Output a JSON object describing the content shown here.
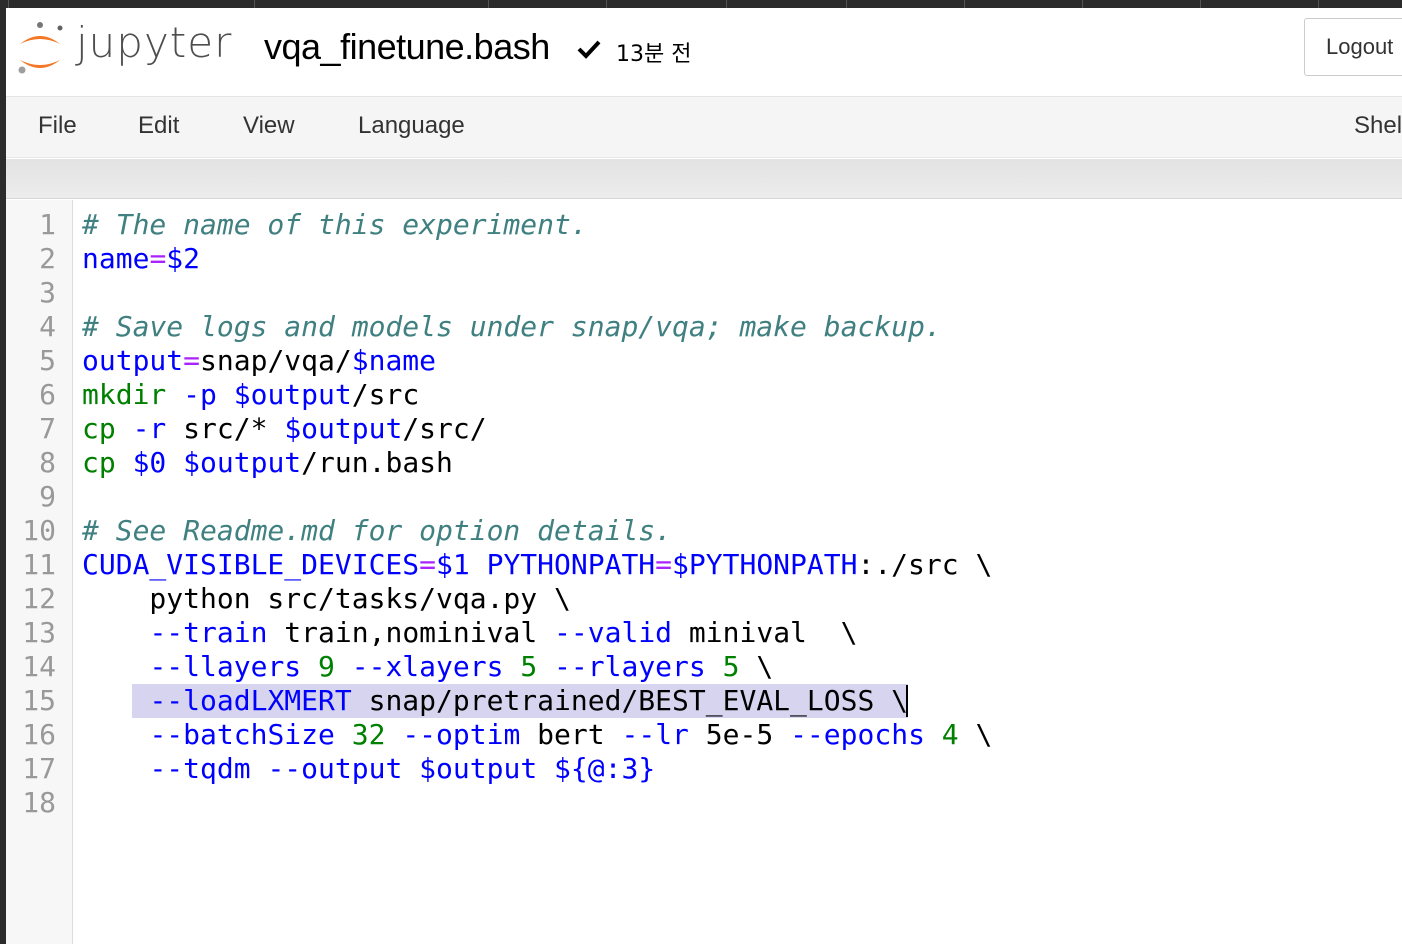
{
  "header": {
    "logo_text": "jupyter",
    "notebook_name": "vqa_finetune.bash",
    "last_saved": "13분 전",
    "logout_label": "Logout"
  },
  "menubar": {
    "items": [
      "File",
      "Edit",
      "View",
      "Language"
    ],
    "right_item": "Shel"
  },
  "editor": {
    "highlighted_line": 15,
    "lines": [
      {
        "n": "1",
        "tokens": [
          [
            "c",
            "# The name of this experiment."
          ]
        ]
      },
      {
        "n": "2",
        "tokens": [
          [
            "v",
            "name"
          ],
          [
            "o",
            "="
          ],
          [
            "v",
            "$2"
          ]
        ]
      },
      {
        "n": "3",
        "tokens": []
      },
      {
        "n": "4",
        "tokens": [
          [
            "c",
            "# Save logs and models under snap/vqa; make backup."
          ]
        ]
      },
      {
        "n": "5",
        "tokens": [
          [
            "v",
            "output"
          ],
          [
            "o",
            "="
          ],
          [
            "p",
            "snap/vqa/"
          ],
          [
            "v",
            "$name"
          ]
        ]
      },
      {
        "n": "6",
        "tokens": [
          [
            "b",
            "mkdir"
          ],
          [
            "p",
            " "
          ],
          [
            "v",
            "-p"
          ],
          [
            "p",
            " "
          ],
          [
            "v",
            "$output"
          ],
          [
            "p",
            "/src"
          ]
        ]
      },
      {
        "n": "7",
        "tokens": [
          [
            "b",
            "cp"
          ],
          [
            "p",
            " "
          ],
          [
            "v",
            "-r"
          ],
          [
            "p",
            " src/* "
          ],
          [
            "v",
            "$output"
          ],
          [
            "p",
            "/src/"
          ]
        ]
      },
      {
        "n": "8",
        "tokens": [
          [
            "b",
            "cp"
          ],
          [
            "p",
            " "
          ],
          [
            "v",
            "$0"
          ],
          [
            "p",
            " "
          ],
          [
            "v",
            "$output"
          ],
          [
            "p",
            "/run.bash"
          ]
        ]
      },
      {
        "n": "9",
        "tokens": []
      },
      {
        "n": "10",
        "tokens": [
          [
            "c",
            "# See Readme.md for option details."
          ]
        ]
      },
      {
        "n": "11",
        "tokens": [
          [
            "v",
            "CUDA_VISIBLE_DEVICES"
          ],
          [
            "o",
            "="
          ],
          [
            "v",
            "$1"
          ],
          [
            "p",
            " "
          ],
          [
            "v",
            "PYTHONPATH"
          ],
          [
            "o",
            "="
          ],
          [
            "v",
            "$PYTHONPATH"
          ],
          [
            "p",
            ":./src \\"
          ]
        ]
      },
      {
        "n": "12",
        "tokens": [
          [
            "p",
            "    python src/tasks/vqa.py \\"
          ]
        ]
      },
      {
        "n": "13",
        "tokens": [
          [
            "p",
            "    "
          ],
          [
            "v",
            "--train"
          ],
          [
            "p",
            " train,nominival "
          ],
          [
            "v",
            "--valid"
          ],
          [
            "p",
            " minival  \\"
          ]
        ]
      },
      {
        "n": "14",
        "tokens": [
          [
            "p",
            "    "
          ],
          [
            "v",
            "--llayers"
          ],
          [
            "p",
            " "
          ],
          [
            "n",
            "9"
          ],
          [
            "p",
            " "
          ],
          [
            "v",
            "--xlayers"
          ],
          [
            "p",
            " "
          ],
          [
            "n",
            "5"
          ],
          [
            "p",
            " "
          ],
          [
            "v",
            "--rlayers"
          ],
          [
            "p",
            " "
          ],
          [
            "n",
            "5"
          ],
          [
            "p",
            " \\"
          ]
        ]
      },
      {
        "n": "15",
        "tokens": [
          [
            "p",
            "    "
          ],
          [
            "v",
            "--loadLXMERT"
          ],
          [
            "p",
            " snap/pretrained/BEST_EVAL_LOSS \\"
          ]
        ]
      },
      {
        "n": "16",
        "tokens": [
          [
            "p",
            "    "
          ],
          [
            "v",
            "--batchSize"
          ],
          [
            "p",
            " "
          ],
          [
            "n",
            "32"
          ],
          [
            "p",
            " "
          ],
          [
            "v",
            "--optim"
          ],
          [
            "p",
            " bert "
          ],
          [
            "v",
            "--lr"
          ],
          [
            "p",
            " 5e-5 "
          ],
          [
            "v",
            "--epochs"
          ],
          [
            "p",
            " "
          ],
          [
            "n",
            "4"
          ],
          [
            "p",
            " \\"
          ]
        ]
      },
      {
        "n": "17",
        "tokens": [
          [
            "p",
            "    "
          ],
          [
            "v",
            "--tqdm"
          ],
          [
            "p",
            " "
          ],
          [
            "v",
            "--output"
          ],
          [
            "p",
            " "
          ],
          [
            "v",
            "$output"
          ],
          [
            "p",
            " "
          ],
          [
            "v",
            "${@:3}"
          ]
        ]
      },
      {
        "n": "18",
        "tokens": []
      }
    ]
  },
  "colors": {
    "comment": "#408080",
    "variable": "#0000ff",
    "operator": "#aa22ff",
    "builtin": "#008000",
    "number": "#008000",
    "highlight": "#d7d4f0"
  }
}
